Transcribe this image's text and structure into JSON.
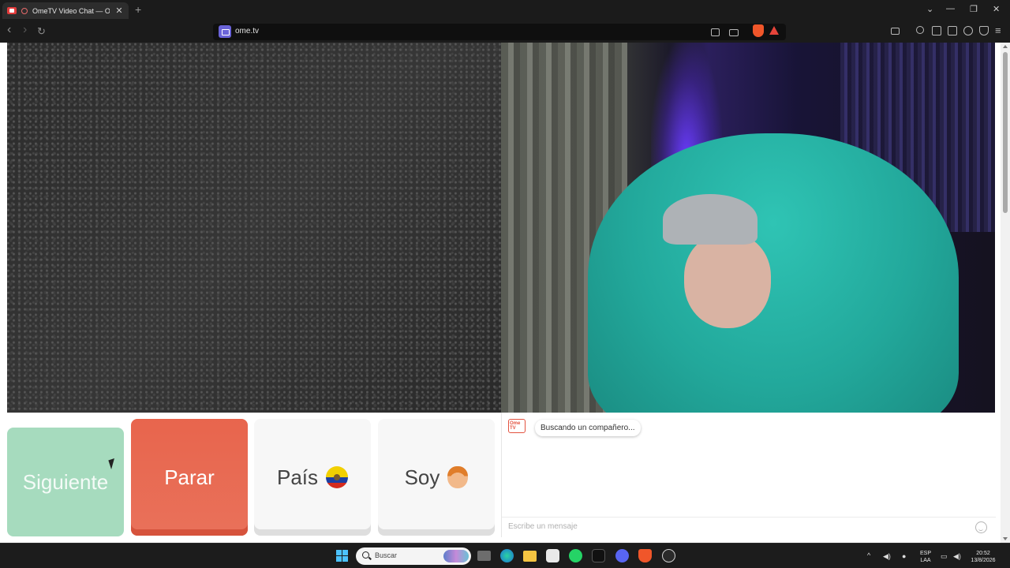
{
  "browser": {
    "tab_title": "OmeTV Video Chat — Omegle",
    "tab_close": "✕",
    "new_tab": "+",
    "url": "ome.tv",
    "window_controls": {
      "dropdown": "⌄",
      "minimize": "—",
      "maximize": "❐",
      "close": "✕"
    },
    "nav": {
      "back": "‹",
      "forward": "›",
      "reload": "↻"
    }
  },
  "controls": {
    "next_label": "Siguiente",
    "stop_label": "Parar",
    "country_label": "País",
    "gender_label": "Soy",
    "next_color": "#a6dbbe",
    "stop_color": "#e8654d"
  },
  "chat": {
    "logo_text": "Ome TV",
    "status_message": "Buscando un compañero...",
    "input_placeholder": "Escribe un mensaje"
  },
  "taskbar": {
    "search_label": "Buscar",
    "lang_top": "ESP",
    "lang_bottom": "LAA",
    "time": "20:52",
    "date": "13/8/2026",
    "tray_chevron": "^",
    "accent": "#4cc2ff"
  }
}
